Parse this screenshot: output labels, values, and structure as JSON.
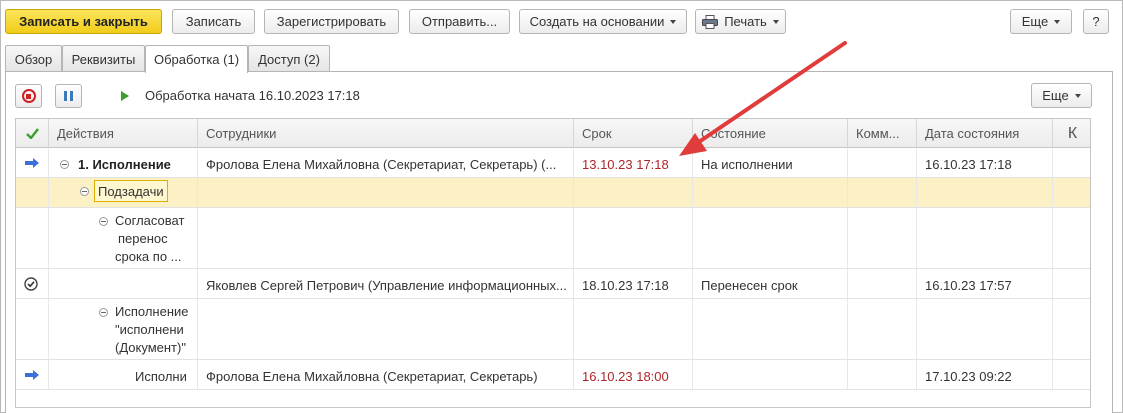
{
  "toolbar": {
    "save_close": "Записать и закрыть",
    "save": "Записать",
    "register": "Зарегистрировать",
    "send": "Отправить...",
    "create_based": "Создать на основании",
    "print": "Печать",
    "more": "Еще",
    "help": "?"
  },
  "tabs": [
    {
      "label": "Обзор"
    },
    {
      "label": "Реквизиты"
    },
    {
      "label": "Обработка (1)"
    },
    {
      "label": "Доступ (2)"
    }
  ],
  "processing": {
    "status": "Обработка начата 16.10.2023 17:18",
    "more": "Еще"
  },
  "table": {
    "columns": {
      "actions": "Действия",
      "employees": "Сотрудники",
      "deadline": "Срок",
      "state": "Состояние",
      "comment": "Комм...",
      "state_date": "Дата состояния",
      "k": "К"
    },
    "rows": [
      {
        "action": "1. Исполнение",
        "employee": "Фролова Елена Михайловна (Секретариат, Секретарь) (...",
        "deadline": "13.10.23 17:18",
        "state": "На исполнении",
        "comment": "",
        "state_date": "16.10.23 17:18"
      },
      {
        "action": "Подзадачи",
        "employee": "",
        "deadline": "",
        "state": "",
        "comment": "",
        "state_date": ""
      },
      {
        "action_lines": [
          "Согласоват",
          "перенос",
          "срока по ..."
        ],
        "employee": "",
        "deadline": "",
        "state": "",
        "comment": "",
        "state_date": ""
      },
      {
        "action": "",
        "employee": "Яковлев Сергей Петрович (Управление информационных...",
        "deadline": "18.10.23 17:18",
        "state": "Перенесен срок",
        "comment": "",
        "state_date": "16.10.23 17:57"
      },
      {
        "action_lines": [
          "Исполнение",
          "\"исполнени",
          "(Документ)\""
        ],
        "employee": "",
        "deadline": "",
        "state": "",
        "comment": "",
        "state_date": ""
      },
      {
        "action": "Исполни",
        "employee": "Фролова Елена Михайловна (Секретариат, Секретарь)",
        "deadline": "16.10.23 18:00",
        "state": "",
        "comment": "",
        "state_date": "17.10.23 09:22"
      }
    ]
  },
  "colors": {
    "primary_button": "#f2cc1a",
    "overdue_text": "#b0252a",
    "selected_row": "#fcf1c4",
    "annotation_arrow": "#e03c3c"
  }
}
